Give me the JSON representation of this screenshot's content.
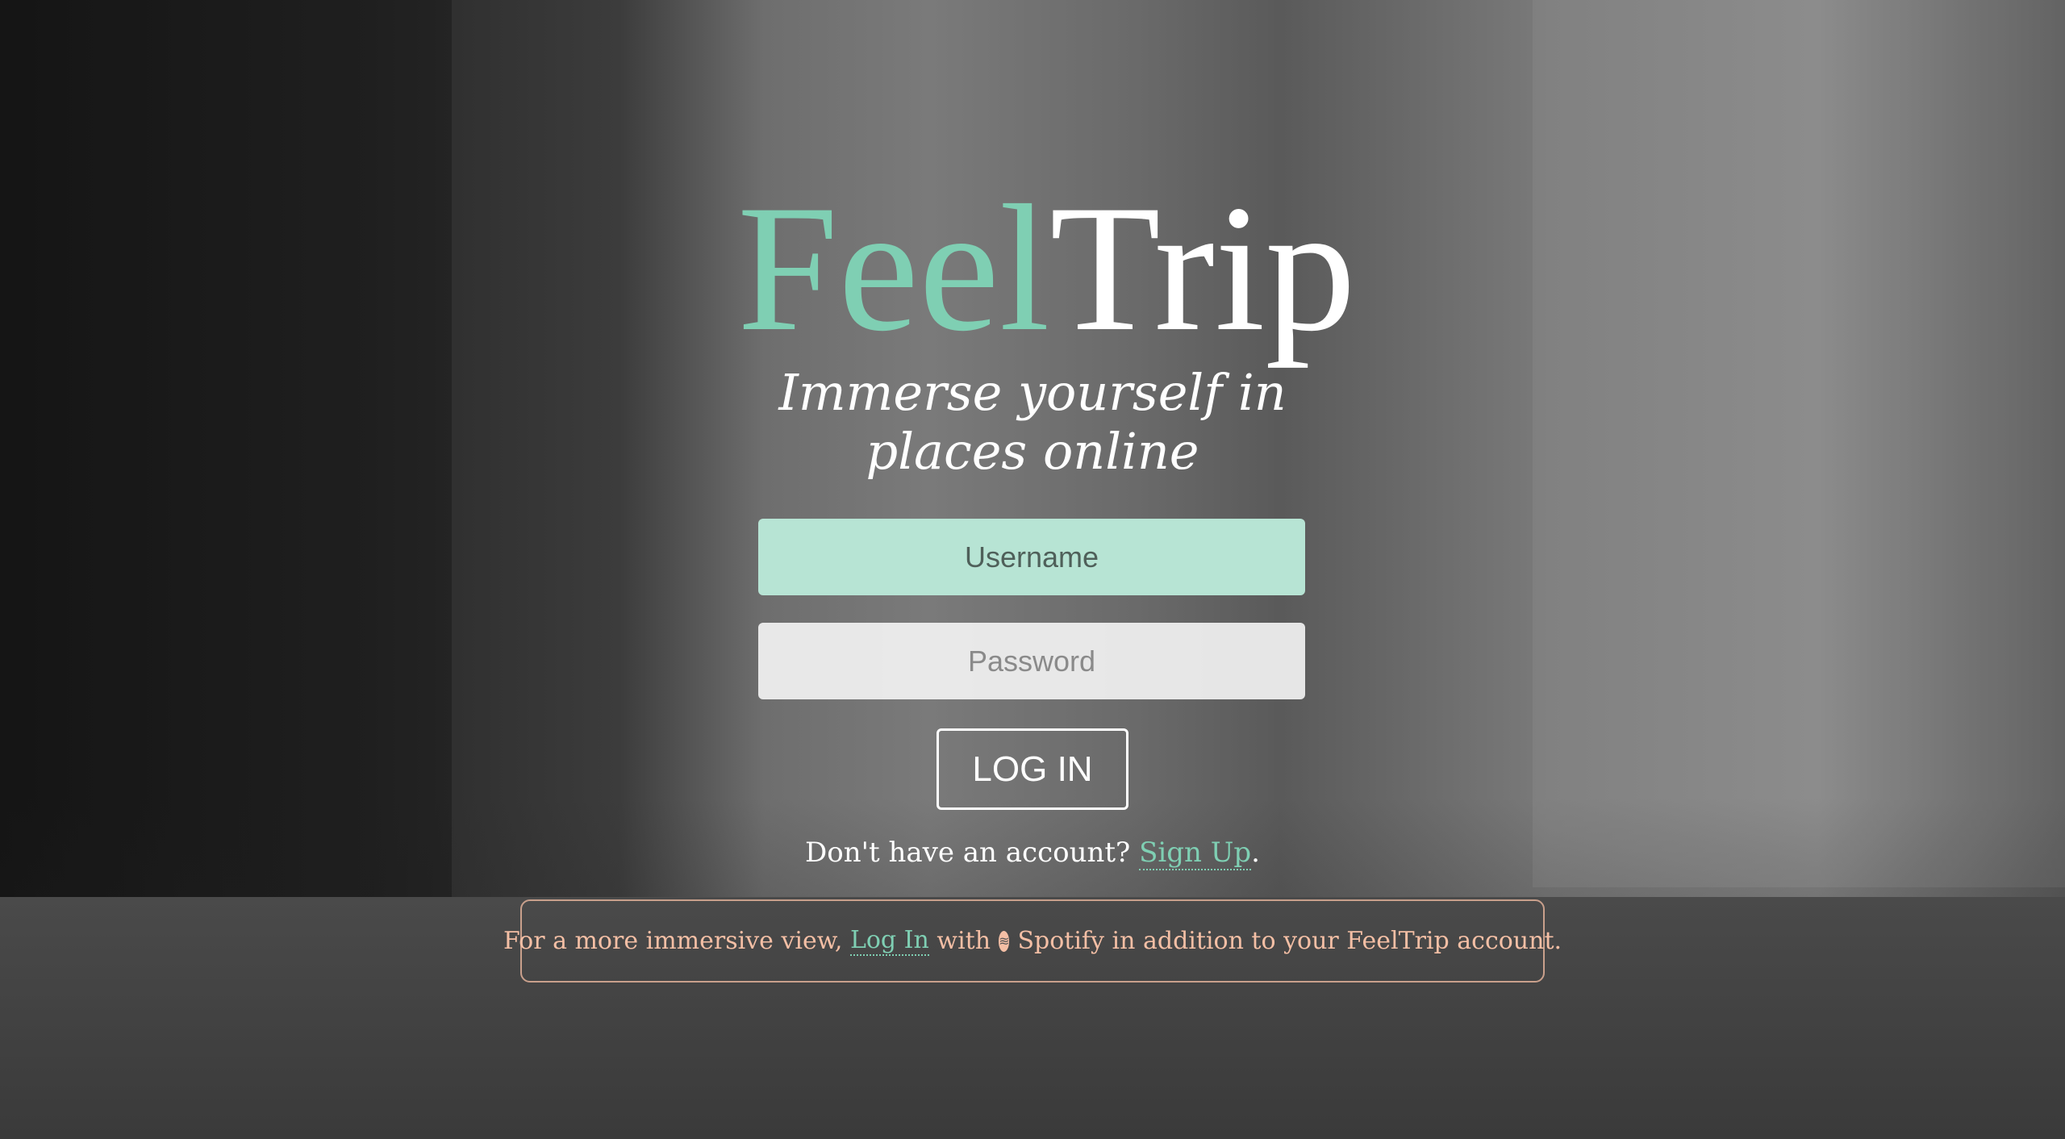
{
  "brand": {
    "part1": "Feel",
    "part2": "Trip",
    "tagline": "Immerse yourself in places online",
    "accent": "#7fcfb3"
  },
  "form": {
    "username_placeholder": "Username",
    "password_placeholder": "Password",
    "login_label": "LOG IN"
  },
  "signup": {
    "prompt": "Don't have an account?",
    "link": "Sign Up",
    "suffix": "."
  },
  "spotify": {
    "prefix": "For a more immersive view,",
    "link": "Log In",
    "middle": "with",
    "icon": "spotify-icon",
    "suffix": "Spotify in addition to your FeelTrip account."
  }
}
